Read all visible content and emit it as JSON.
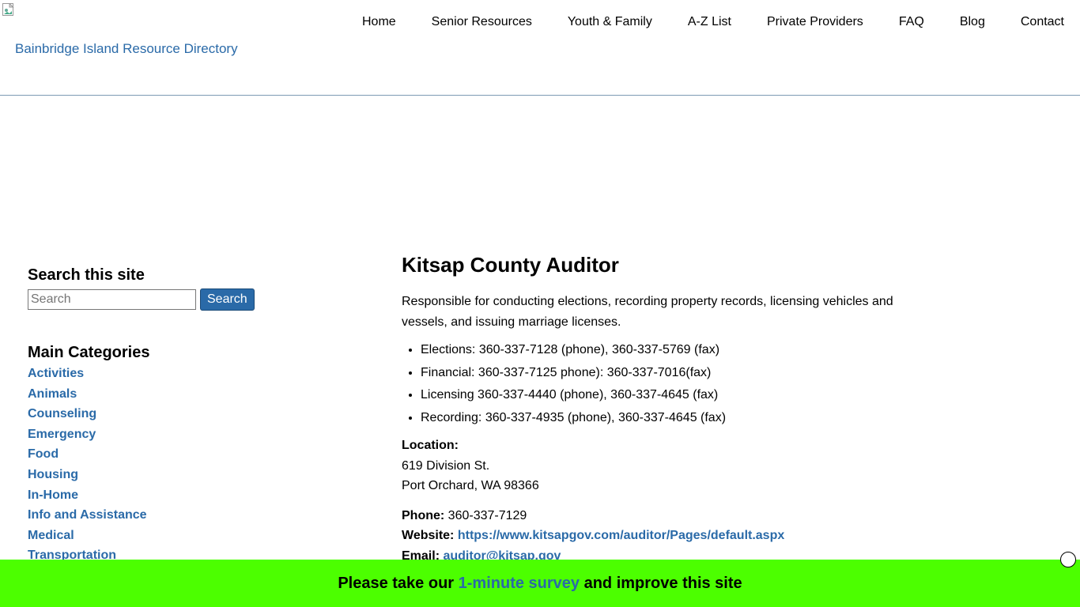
{
  "header": {
    "site_title": "Bainbridge Island Resource Directory",
    "nav": [
      "Home",
      "Senior Resources",
      "Youth & Family",
      "A-Z List",
      "Private Providers",
      "FAQ",
      "Blog",
      "Contact"
    ]
  },
  "sidebar": {
    "search_heading": "Search this site",
    "search_placeholder": "Search",
    "search_button": "Search",
    "categories_heading": "Main Categories",
    "categories": [
      "Activities",
      "Animals",
      "Counseling",
      "Emergency",
      "Food",
      "Housing",
      "In-Home",
      "Info and Assistance",
      "Medical",
      "Transportation"
    ]
  },
  "main": {
    "title": "Kitsap County Auditor",
    "description": "Responsible for conducting elections, recording property records, licensing vehicles and vessels, and issuing marriage licenses.",
    "items": [
      "Elections: 360-337-7128 (phone), 360-337-5769 (fax)",
      "Financial: 360-337-7125 phone): 360-337-7016(fax)",
      "Licensing 360-337-4440 (phone), 360-337-4645 (fax)",
      "Recording: 360-337-4935 (phone), 360-337-4645 (fax)"
    ],
    "location_label": "Location:",
    "address_line1": "619 Division St.",
    "address_line2": "Port Orchard, WA 98366",
    "phone_label": "Phone:",
    "phone": "360-337-7129",
    "website_label": "Website:",
    "website": "https://www.kitsapgov.com/auditor/Pages/default.aspx",
    "email_label": "Email:",
    "email": "auditor@kitsap.gov"
  },
  "survey": {
    "prefix": "Please take our",
    "link": "1-minute survey",
    "suffix": "and improve this site"
  },
  "colors": {
    "link": "#2a6aa8",
    "survey_bg": "#4cff00",
    "search_button_bg": "#2a6aa8"
  }
}
